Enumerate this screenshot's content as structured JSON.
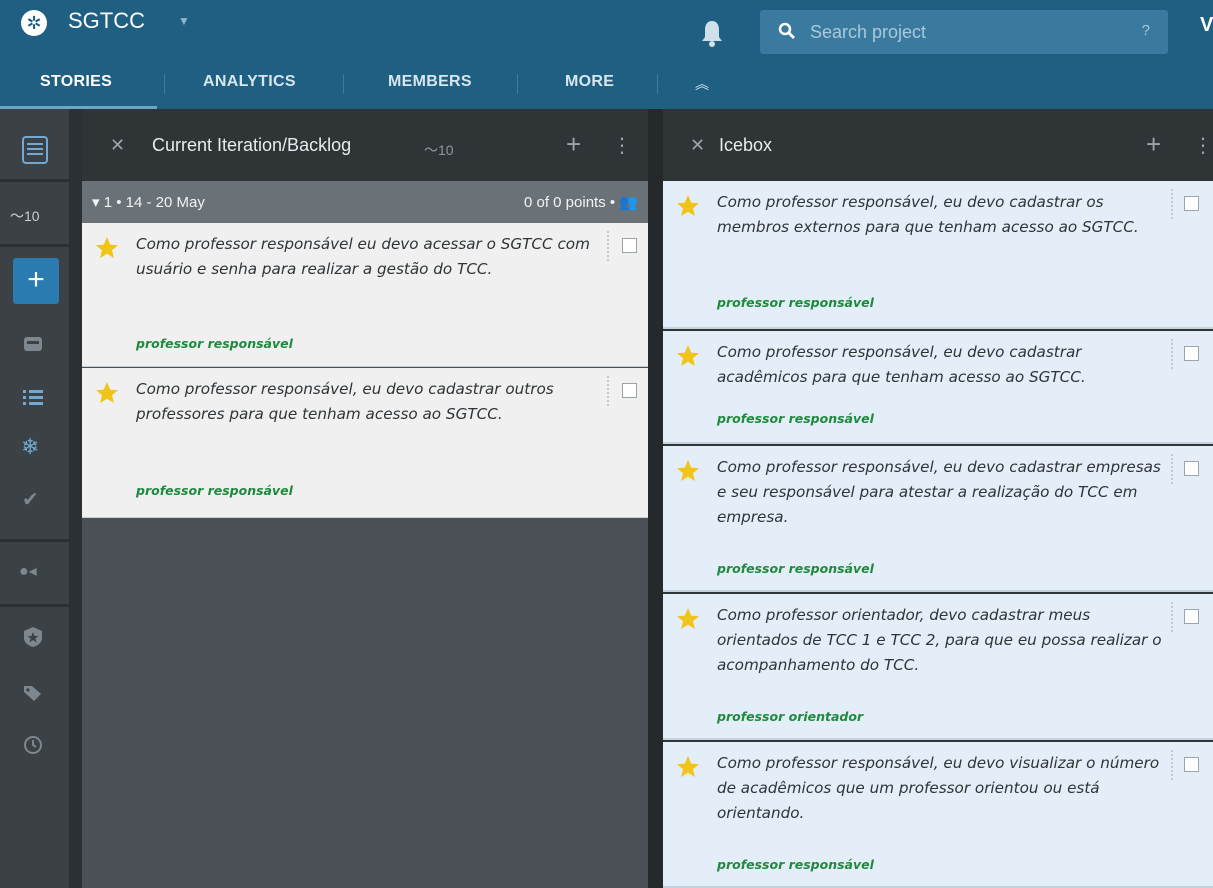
{
  "header": {
    "project_name": "SGTCC",
    "search_placeholder": "Search project",
    "search_help": "?",
    "user_initial": "V"
  },
  "nav": {
    "tabs": [
      {
        "label": "STORIES"
      },
      {
        "label": "ANALYTICS"
      },
      {
        "label": "MEMBERS"
      },
      {
        "label": "MORE"
      }
    ]
  },
  "rail": {
    "points": "10"
  },
  "backlog": {
    "title": "Current Iteration/Backlog",
    "points": "10",
    "iteration": {
      "label": "1 • 14 - 20 May",
      "points_text": "0 of 0 points •"
    },
    "stories": [
      {
        "text": "Como professor responsável eu devo acessar o SGTCC com usuário e senha para realizar a gestão do TCC.",
        "label": "professor responsável"
      },
      {
        "text": "Como professor responsável, eu devo cadastrar outros professores para que tenham acesso ao SGTCC.",
        "label": "professor responsável"
      }
    ]
  },
  "icebox": {
    "title": "Icebox",
    "stories": [
      {
        "text": "Como professor responsável, eu devo cadastrar os membros externos para que tenham acesso ao SGTCC.",
        "label": "professor responsável"
      },
      {
        "text": "Como professor responsável, eu devo cadastrar acadêmicos para que tenham acesso ao SGTCC.",
        "label": "professor responsável"
      },
      {
        "text": "Como professor responsável, eu devo cadastrar empresas e seu responsável para atestar a realização do TCC em empresa.",
        "label": "professor responsável"
      },
      {
        "text": "Como professor orientador, devo cadastrar meus orientados de TCC 1 e TCC 2, para que eu possa realizar o acompanhamento do TCC.",
        "label": "professor orientador"
      },
      {
        "text": "Como professor responsável, eu devo visualizar o número de acadêmicos que um professor orientou ou está orientando.",
        "label": "professor responsável"
      }
    ]
  },
  "colors": {
    "header": "#1f5f82",
    "label_green": "#1f8a3d",
    "icebox_story": "#e3eef8",
    "star": "#f0c419"
  }
}
